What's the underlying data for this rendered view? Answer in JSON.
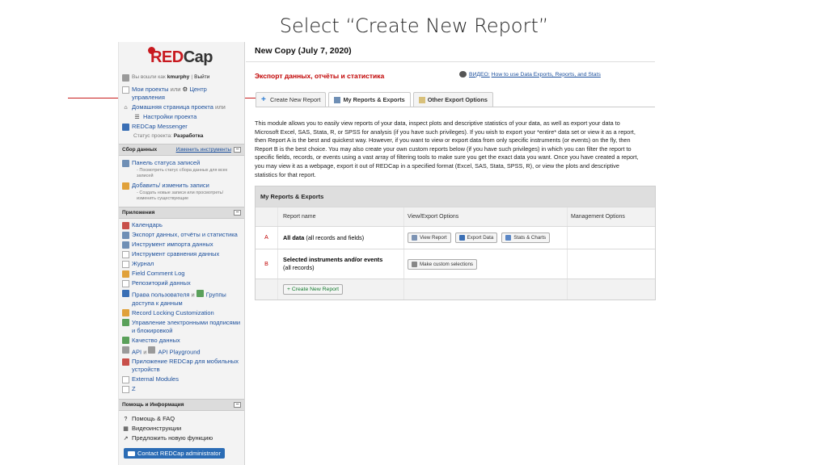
{
  "slide": {
    "title": "Select “Create New Report”"
  },
  "sidebar": {
    "logo_red": "RED",
    "logo_gray": "Cap",
    "logged_in_prefix": "Вы вошли как",
    "username": "kmurphy",
    "separator": "|",
    "logout": "Выйти",
    "my_projects": "Мои проекты",
    "or1": "или",
    "control_center": "Центр управления",
    "project_home": "Домашняя страница проекта",
    "or2": "или",
    "project_setup": "Настройки проекта",
    "messenger": "REDCap Messenger",
    "status_label": "Статус проекта:",
    "status_value": "Разработка",
    "data_collection": {
      "title": "Сбор данных",
      "edit_instruments": "Изменить инструменты",
      "status_dashboard": "Панель статуса записей",
      "status_dashboard_desc": "- Посмотреть статус сбора данных для всех записей",
      "add_edit": "Добавить/ изменить записи",
      "add_edit_desc": "- Создать новые записи или просмотреть/ изменить существующие"
    },
    "applications": {
      "title": "Приложения",
      "items": [
        "Календарь",
        "Экспорт данных, отчёты и статистика",
        "Инструмент импорта данных",
        "Инструмент сравнения данных",
        "Журнал",
        "Field Comment Log",
        "Репозиторий данных",
        "Права пользователя",
        "и",
        "Группы доступа к данным",
        "Record Locking Customization",
        "Управление электронными подписями и блокировкой",
        "Качество данных",
        "API",
        "и",
        "API Playground",
        "Приложение REDCap для мобильных устройств",
        "External Modules",
        "Z"
      ]
    },
    "help": {
      "title": "Помощь и Информация",
      "faq": "Помощь & FAQ",
      "videos": "Видеоинструкции",
      "suggest": "Предложить новую функцию",
      "contact": "Contact REDCap administrator"
    }
  },
  "main": {
    "project_title": "New Copy (July 7, 2020)",
    "module_title": "Экспорт данных, отчёты и статистика",
    "video_prefix": "ВИДЕО:",
    "video_link": "How to use Data Exports, Reports, and Stats",
    "tabs": [
      {
        "label": "Create New Report",
        "icon": "plus-icon"
      },
      {
        "label": "My Reports & Exports",
        "icon": "reports-icon"
      },
      {
        "label": "Other Export Options",
        "icon": "folder-icon"
      }
    ],
    "description": "This module allows you to easily view reports of your data, inspect plots and descriptive statistics of your data, as well as export your data to Microsoft Excel, SAS, Stata, R, or SPSS for analysis (if you have such privileges). If you wish to export your *entire* data set or view it as a report, then Report A is the best and quickest way. However, if you want to view or export data from only specific instruments (or events) on the fly, then Report B is the best choice. You may also create your own custom reports below (if you have such privileges) in which you can filter the report to specific fields, records, or events using a vast array of filtering tools to make sure you get the exact data you want. Once you have created a report, you may view it as a webpage, export it out of REDCap in a specified format (Excel, SAS, Stata, SPSS, R), or view the plots and descriptive statistics for that report.",
    "table": {
      "title": "My Reports & Exports",
      "col_report_name": "Report name",
      "col_view_export": "View/Export Options",
      "col_management": "Management Options",
      "row_a": {
        "letter": "A",
        "name_bold": "All data",
        "name_rest": "(all records and fields)",
        "btn_view": "View Report",
        "btn_export": "Export Data",
        "btn_stats": "Stats & Charts"
      },
      "row_b": {
        "letter": "B",
        "name_bold": "Selected instruments and/or events",
        "name_rest": "(all records)",
        "btn_custom": "Make custom selections"
      },
      "create_button": "+ Create New Report"
    }
  },
  "colors": {
    "accent_red": "#c00000",
    "link_blue": "#1b4f9c",
    "arrow": "#c81e1e"
  }
}
